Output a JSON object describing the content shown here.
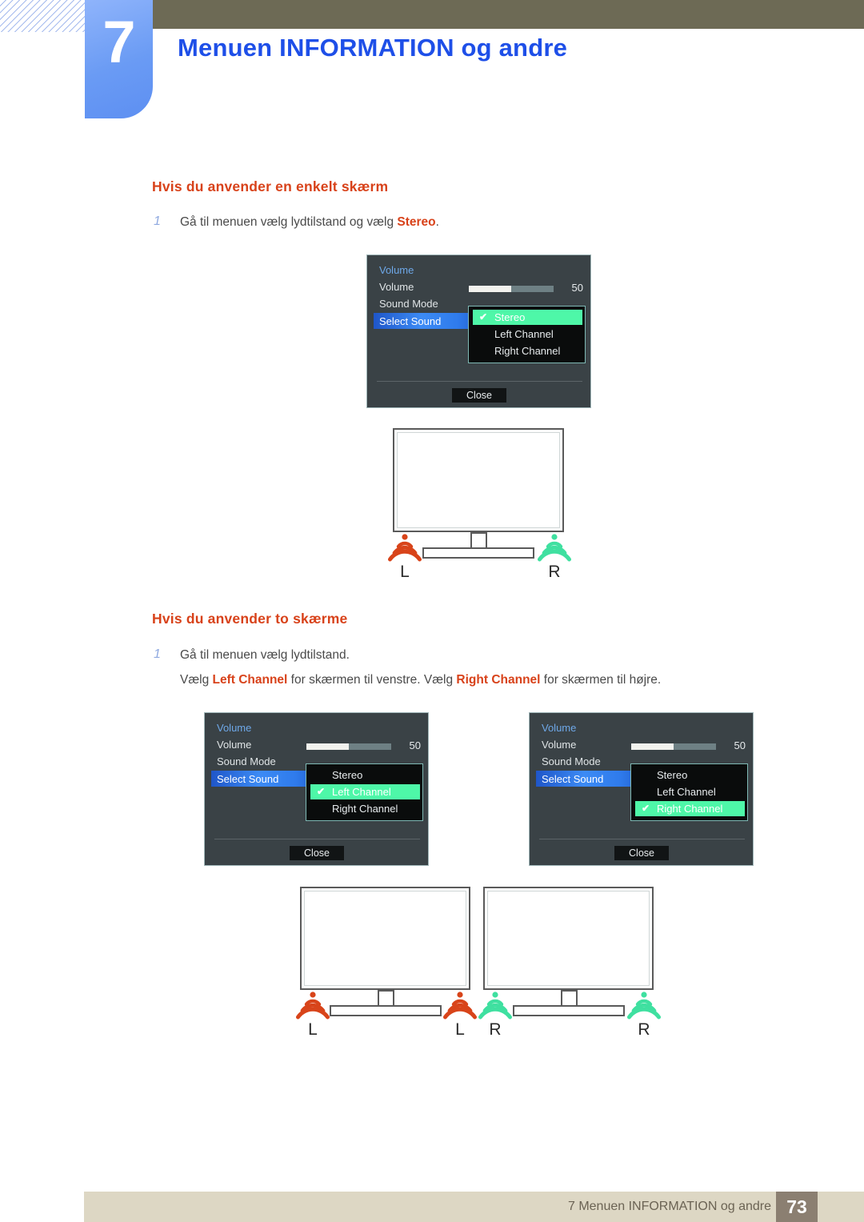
{
  "header": {
    "chapter_number": "7",
    "title": "Menuen INFORMATION og andre",
    "accent_blue": "#1e4fe8",
    "tab_blue": "#6a9bf4",
    "olive": "#6d6a55"
  },
  "sections": [
    {
      "heading": "Hvis du anvender en enkelt skærm",
      "steps": [
        {
          "number": "1",
          "lines": [
            {
              "pre": "Gå til menuen vælg lydtilstand og vælg ",
              "bold": "Stereo",
              "post": "."
            }
          ]
        }
      ]
    },
    {
      "heading": "Hvis du anvender to skærme",
      "steps": [
        {
          "number": "1",
          "lines": [
            {
              "pre": "Gå til menuen vælg lydtilstand.",
              "bold": "",
              "post": ""
            },
            {
              "pre": "Vælg ",
              "bold": "Left Channel",
              "mid": " for skærmen til venstre. Vælg ",
              "bold2": "Right Channel",
              "post": " for skærmen til højre."
            }
          ]
        }
      ]
    }
  ],
  "osd": {
    "title": "Volume",
    "rows": [
      {
        "label": "Volume"
      },
      {
        "label": "Sound Mode"
      },
      {
        "label": "Select Sound"
      }
    ],
    "slider": {
      "value": "50",
      "percent": 50
    },
    "submenu_options": [
      "Stereo",
      "Left Channel",
      "Right Channel"
    ],
    "close_label": "Close",
    "checkmark": "✔",
    "colors": {
      "panel_bg": "#3a4246",
      "panel_border": "#9fb6b8",
      "title_blue": "#6ea8e8",
      "select_blue": "#3c8bf5",
      "submenu_bg": "#0a0c0c",
      "submenu_border": "#7fb9b5",
      "highlight_green": "#4ef7a8",
      "slider_fill": "#f2f2ee",
      "slider_track": "#6e8084"
    },
    "instances": [
      {
        "name": "single-screen-stereo",
        "selected_option": "Stereo"
      },
      {
        "name": "dual-screen-left",
        "selected_option": "Left Channel"
      },
      {
        "name": "dual-screen-right",
        "selected_option": "Right Channel"
      }
    ]
  },
  "diagrams": {
    "single": {
      "speakers": [
        {
          "side": "left",
          "label": "L",
          "color": "#d8441a"
        },
        {
          "side": "right",
          "label": "R",
          "color": "#3fe0a0"
        }
      ]
    },
    "dual": {
      "monitor_left": {
        "speakers": [
          {
            "side": "left",
            "label": "L",
            "color": "#d8441a"
          },
          {
            "side": "right",
            "label": "L",
            "color": "#d8441a"
          }
        ]
      },
      "monitor_right": {
        "speakers": [
          {
            "side": "left",
            "label": "R",
            "color": "#3fe0a0"
          },
          {
            "side": "right",
            "label": "R",
            "color": "#3fe0a0"
          }
        ]
      }
    }
  },
  "footer": {
    "text": "7 Menuen INFORMATION og andre",
    "page": "73",
    "bar_color": "#ddd7c4",
    "page_badge_color": "#8b7f71"
  }
}
